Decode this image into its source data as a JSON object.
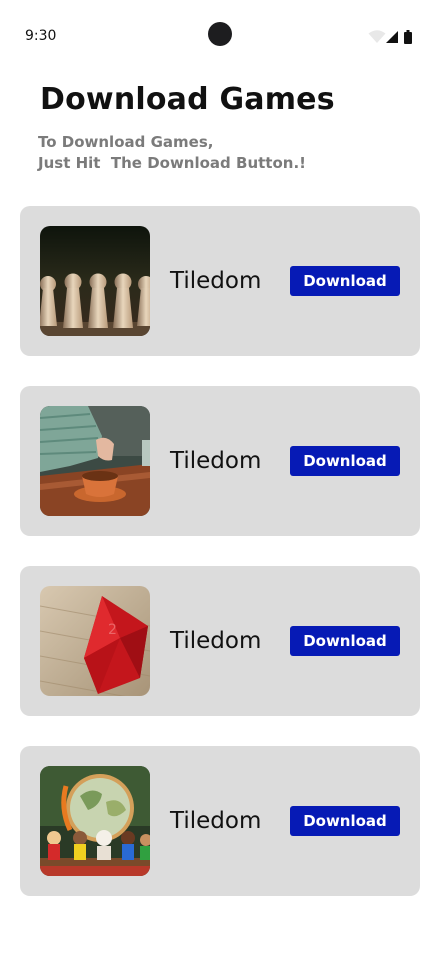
{
  "status_bar": {
    "time": "9:30",
    "icons": [
      "wifi-icon",
      "signal-icon",
      "battery-icon"
    ]
  },
  "header": {
    "title": "Download Games",
    "subtitle_line1": "To Download Games,",
    "subtitle_line2": "Just Hit  The Download Button.!"
  },
  "games": [
    {
      "name": "Tiledom",
      "button_label": "Download",
      "image": "wooden-pawns-image"
    },
    {
      "name": "Tiledom",
      "button_label": "Download",
      "image": "child-tea-cup-image"
    },
    {
      "name": "Tiledom",
      "button_label": "Download",
      "image": "red-dice-image"
    },
    {
      "name": "Tiledom",
      "button_label": "Download",
      "image": "globe-figurines-image"
    }
  ],
  "colors": {
    "background": "#ffffff",
    "card": "#dcdcdc",
    "button": "#061ab5",
    "subtitle": "#7b7b7b"
  }
}
